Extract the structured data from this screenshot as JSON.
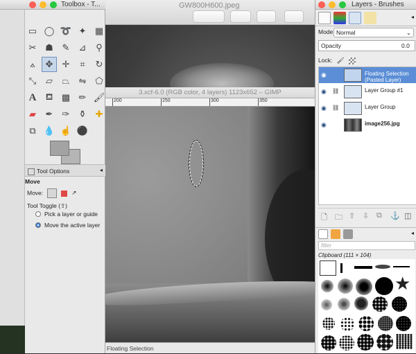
{
  "preview_window": {
    "title": "GW800H600.jpeg"
  },
  "image_window": {
    "title": "3.xcf-6.0 (RGB color, 4 layers) 1123x652 – GIMP",
    "ruler_ticks": [
      "200",
      "250",
      "300",
      "350"
    ],
    "status": "Floating Selection"
  },
  "toolbox": {
    "title": "Toolbox - T...",
    "tool_options_tab": "Tool Options",
    "tool_name": "Move",
    "move_label": "Move:",
    "tool_toggle_label": "Tool Toggle",
    "tool_toggle_shortcut": "(⇧)",
    "options": [
      {
        "label": "Pick a layer or guide",
        "selected": false
      },
      {
        "label": "Move the active layer",
        "selected": true
      }
    ],
    "fg_color": "#a3a3a3",
    "bg_color": "#b5b5b5"
  },
  "layers_dock": {
    "title": "Layers - Brushes",
    "mode_label": "Mode:",
    "mode_value": "Normal",
    "opacity_label": "Opacity",
    "opacity_value": "0.0",
    "lock_label": "Lock:",
    "layers": [
      {
        "name": "Floating Selection",
        "name2": "(Pasted Layer)",
        "selected": true
      },
      {
        "name": "Layer Group #1",
        "selected": false
      },
      {
        "name": "Layer Group",
        "selected": false
      },
      {
        "name": "image256.jpg",
        "selected": false
      }
    ],
    "filter_placeholder": "filter",
    "clipboard_label": "Clipboard (111 × 104)",
    "accent": "#5b8ed6"
  }
}
